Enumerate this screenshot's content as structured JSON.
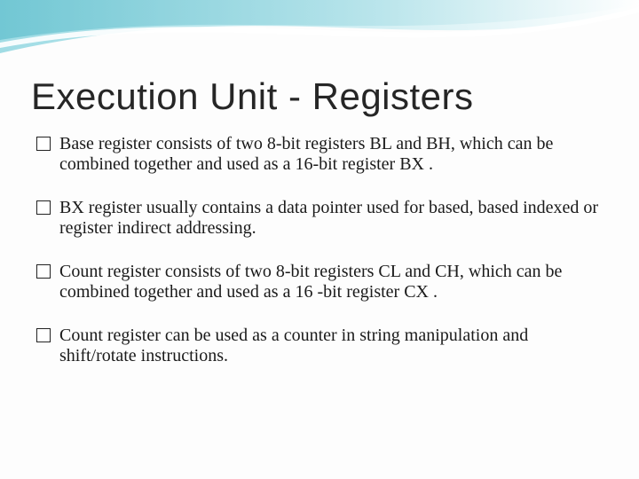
{
  "slide": {
    "title": "Execution Unit - Registers",
    "bullets": [
      "Base register consists of two 8-bit registers BL and BH, which can be combined together and used as a 16-bit register BX .",
      "BX register usually contains a data pointer used for based, based indexed or register indirect addressing.",
      "Count register consists of two 8-bit registers CL and CH, which can be combined together and used as a 16 -bit register CX .",
      "Count register can be used as a counter in string manipulation and shift/rotate instructions."
    ]
  },
  "theme": {
    "accent": "#6fc7d4",
    "accent_dark": "#2a9cb0"
  }
}
